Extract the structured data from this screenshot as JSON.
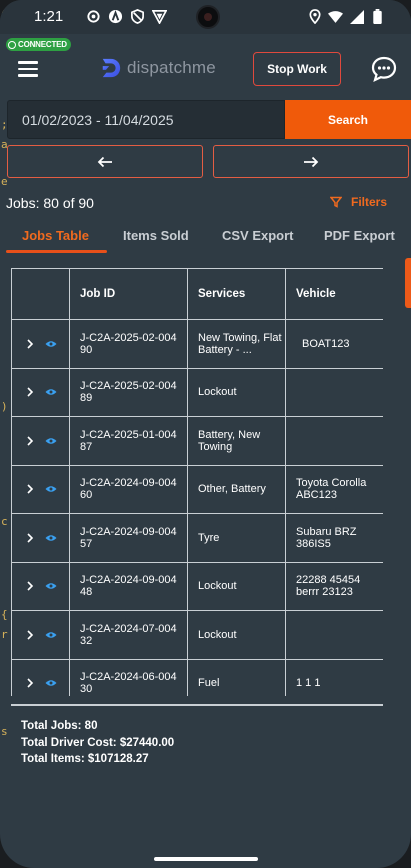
{
  "status_bar": {
    "time": "1:21"
  },
  "connection": {
    "label": "CONNECTED"
  },
  "header": {
    "logo_text": "dispatchme",
    "stop_work_label": "Stop Work"
  },
  "search": {
    "date_range": "01/02/2023 - 11/04/2025",
    "search_label": "Search"
  },
  "nav": {
    "prev_label": "←",
    "next_label": "→"
  },
  "summary": {
    "jobs_count": "Jobs: 80 of 90",
    "filters_label": "Filters"
  },
  "tabs": [
    {
      "label": "Jobs Table",
      "active": true
    },
    {
      "label": "Items Sold",
      "active": false
    },
    {
      "label": "CSV Export",
      "active": false
    },
    {
      "label": "PDF Export",
      "active": false
    }
  ],
  "table": {
    "headers": [
      "",
      "Job ID",
      "Services",
      "Vehicle"
    ],
    "rows": [
      {
        "job_id": "J-C2A-2025-02-004 90",
        "services": "New Towing, Flat Battery - ...",
        "vehicle": "BOAT123"
      },
      {
        "job_id": "J-C2A-2025-02-004 89",
        "services": "Lockout",
        "vehicle": ""
      },
      {
        "job_id": "J-C2A-2025-01-004 87",
        "services": "Battery, New Towing",
        "vehicle": ""
      },
      {
        "job_id": "J-C2A-2024-09-004 60",
        "services": "Other, Battery",
        "vehicle": "Toyota Corolla ABC123"
      },
      {
        "job_id": "J-C2A-2024-09-004 57",
        "services": "Tyre",
        "vehicle": "Subaru BRZ 386IS5"
      },
      {
        "job_id": "J-C2A-2024-09-004 48",
        "services": "Lockout",
        "vehicle": "22288 45454 berrr 23123"
      },
      {
        "job_id": "J-C2A-2024-07-004 32",
        "services": "Lockout",
        "vehicle": ""
      },
      {
        "job_id": "J-C2A-2024-06-004 30",
        "services": "Fuel",
        "vehicle": "1 1 1"
      }
    ]
  },
  "totals": {
    "jobs": "Total Jobs: 80",
    "driver_cost": "Total Driver Cost: $27440.00",
    "items": "Total Items: $107128.27"
  },
  "colors": {
    "accent": "#f05a0a",
    "background": "#2f3b44",
    "connected": "#2ea043",
    "stop_border": "#e0493d",
    "eye_icon": "#3aa0f0"
  }
}
